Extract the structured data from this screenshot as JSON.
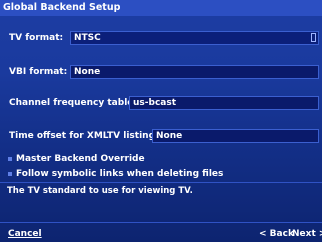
{
  "window": {
    "title": "Global Backend Setup"
  },
  "settings": {
    "tv_format": {
      "label": "TV format:",
      "value": "NTSC"
    },
    "vbi_format": {
      "label": "VBI format:",
      "value": "None"
    },
    "channel_frequency_table": {
      "label": "Channel frequency table:",
      "value": "us-bcast"
    },
    "time_offset_xmltv": {
      "label": "Time offset for XMLTV listings:",
      "value": "None"
    },
    "master_backend_override": {
      "label": "Master Backend Override"
    },
    "follow_symbolic_links": {
      "label": "Follow symbolic links when deleting files"
    }
  },
  "help_text": "The TV standard to use for viewing TV.",
  "buttons": {
    "cancel": "Cancel",
    "back": "< Back",
    "next": "Next >"
  },
  "colors": {
    "background": "#1a3a9e",
    "title_bar": "#2c4fc2",
    "field_bg": "#0b1f7a",
    "text": "#ffffff"
  }
}
